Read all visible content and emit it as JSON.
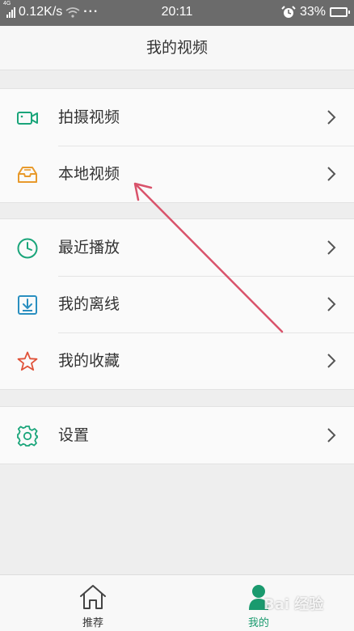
{
  "status_bar": {
    "network_tag": "4G",
    "speed": "0.12K/s",
    "more": "···",
    "time": "20:11",
    "battery": "33%"
  },
  "header": {
    "title": "我的视频"
  },
  "sections": [
    {
      "items": [
        {
          "label": "拍摄视频",
          "icon": "video-camera-icon",
          "color": "#1aa57a"
        },
        {
          "label": "本地视频",
          "icon": "local-box-icon",
          "color": "#e89a2c"
        }
      ]
    },
    {
      "items": [
        {
          "label": "最近播放",
          "icon": "clock-icon",
          "color": "#1aa57a"
        },
        {
          "label": "我的离线",
          "icon": "download-icon",
          "color": "#2a8fc0"
        },
        {
          "label": "我的收藏",
          "icon": "star-icon",
          "color": "#e0533a"
        }
      ]
    },
    {
      "items": [
        {
          "label": "设置",
          "icon": "gear-icon",
          "color": "#1aa57a"
        }
      ]
    }
  ],
  "bottom_nav": [
    {
      "label": "推荐",
      "icon": "home-icon",
      "active": false
    },
    {
      "label": "我的",
      "icon": "person-icon",
      "active": true,
      "color": "#1a9a6e"
    }
  ],
  "annotation": {
    "arrow_color": "#d9536b"
  },
  "watermark": {
    "text": "Bai 经验"
  }
}
